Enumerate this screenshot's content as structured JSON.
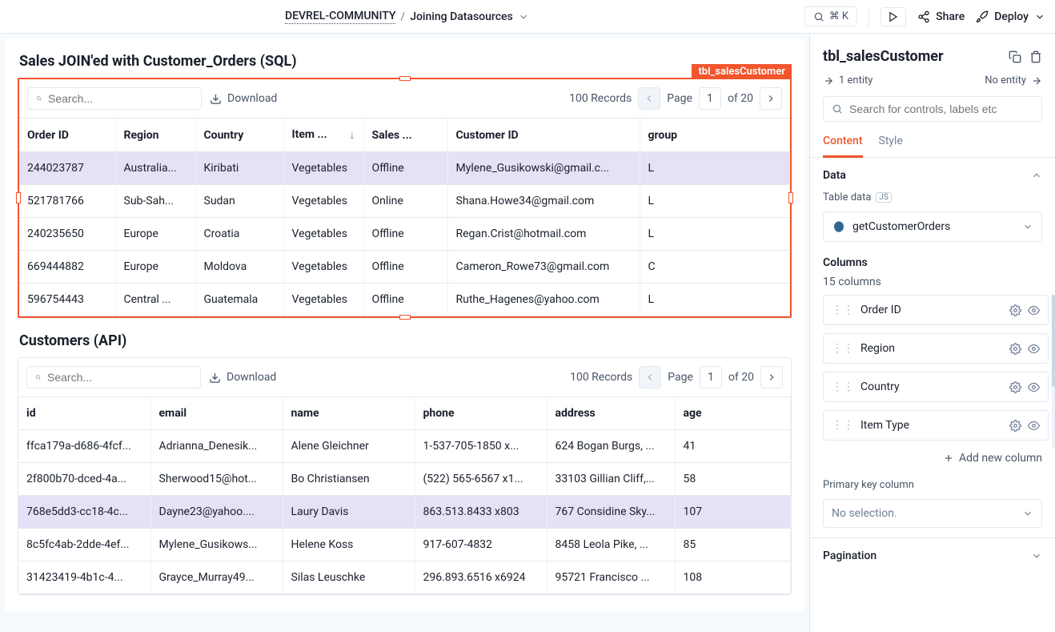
{
  "breadcrumb": {
    "project": "DEVREL-COMMUNITY",
    "page": "Joining Datasources"
  },
  "cmd": {
    "shortcut": "⌘ K"
  },
  "topbar": {
    "share": "Share",
    "deploy": "Deploy"
  },
  "sales": {
    "title": "Sales JOIN'ed with Customer_Orders (SQL)",
    "badge": "tbl_salesCustomer",
    "searchPlaceholder": "Search...",
    "download": "Download",
    "records": "100 Records",
    "pageLabel": "Page",
    "pageNum": "1",
    "ofPages": "of 20",
    "headers": [
      "Order ID",
      "Region",
      "Country",
      "Item ...",
      "Sales ...",
      "Customer ID",
      "group"
    ],
    "rows": [
      {
        "order": "244023787",
        "region": "Australia...",
        "country": "Kiribati",
        "item": "Vegetables",
        "channel": "Offline",
        "cust": "Mylene_Gusikowski@gmail.c...",
        "group": "L",
        "hl": true
      },
      {
        "order": "521781766",
        "region": "Sub-Sah...",
        "country": "Sudan",
        "item": "Vegetables",
        "channel": "Online",
        "cust": "Shana.Howe34@gmail.com",
        "group": "L",
        "hl": false
      },
      {
        "order": "240235650",
        "region": "Europe",
        "country": "Croatia",
        "item": "Vegetables",
        "channel": "Offline",
        "cust": "Regan.Crist@hotmail.com",
        "group": "L",
        "hl": false
      },
      {
        "order": "669444882",
        "region": "Europe",
        "country": "Moldova",
        "item": "Vegetables",
        "channel": "Offline",
        "cust": "Cameron_Rowe73@gmail.com",
        "group": "C",
        "hl": false
      },
      {
        "order": "596754443",
        "region": "Central ...",
        "country": "Guatemala",
        "item": "Vegetables",
        "channel": "Offline",
        "cust": "Ruthe_Hagenes@yahoo.com",
        "group": "L",
        "hl": false
      }
    ]
  },
  "customers": {
    "title": "Customers (API)",
    "searchPlaceholder": "Search...",
    "download": "Download",
    "records": "100 Records",
    "pageLabel": "Page",
    "pageNum": "1",
    "ofPages": "of 20",
    "headers": [
      "id",
      "email",
      "name",
      "phone",
      "address",
      "age"
    ],
    "rows": [
      {
        "id": "ffca179a-d686-4fcf...",
        "email": "Adrianna_Denesik...",
        "name": "Alene Gleichner",
        "phone": "1-537-705-1850 x...",
        "address": "624 Bogan Burgs, ...",
        "age": "41",
        "hl": false
      },
      {
        "id": "2f800b70-dced-4a...",
        "email": "Sherwood15@hot...",
        "name": "Bo Christiansen",
        "phone": "(522) 565-6567 x1...",
        "address": "33103 Gillian Cliff,...",
        "age": "58",
        "hl": false
      },
      {
        "id": "768e5dd3-cc18-4c...",
        "email": "Dayne23@yahoo....",
        "name": "Laury Davis",
        "phone": "863.513.8433 x803",
        "address": "767 Considine Sky...",
        "age": "107",
        "hl": true
      },
      {
        "id": "8c5fc4ab-2dde-4ef...",
        "email": "Mylene_Gusikows...",
        "name": "Helene Koss",
        "phone": "917-607-4832",
        "address": "8458 Leola Pike, ...",
        "age": "85",
        "hl": false
      },
      {
        "id": "31423419-4b1c-4...",
        "email": "Grayce_Murray49...",
        "name": "Silas Leuschke",
        "phone": "296.893.6516 x6924",
        "address": "95721 Francisco ...",
        "age": "108",
        "hl": false
      }
    ]
  },
  "rpanel": {
    "title": "tbl_salesCustomer",
    "entityIn": "1 entity",
    "entityOut": "No entity",
    "searchPlaceholder": "Search for controls, labels etc",
    "tabs": {
      "content": "Content",
      "style": "Style"
    },
    "dataHeader": "Data",
    "tableDataLabel": "Table data",
    "tableDataValue": "getCustomerOrders",
    "columnsHeader": "Columns",
    "columnsCount": "15 columns",
    "columnItems": [
      "Order ID",
      "Region",
      "Country",
      "Item Type"
    ],
    "addColumn": "Add new column",
    "pkLabel": "Primary key column",
    "pkValue": "No selection.",
    "pagination": "Pagination"
  }
}
